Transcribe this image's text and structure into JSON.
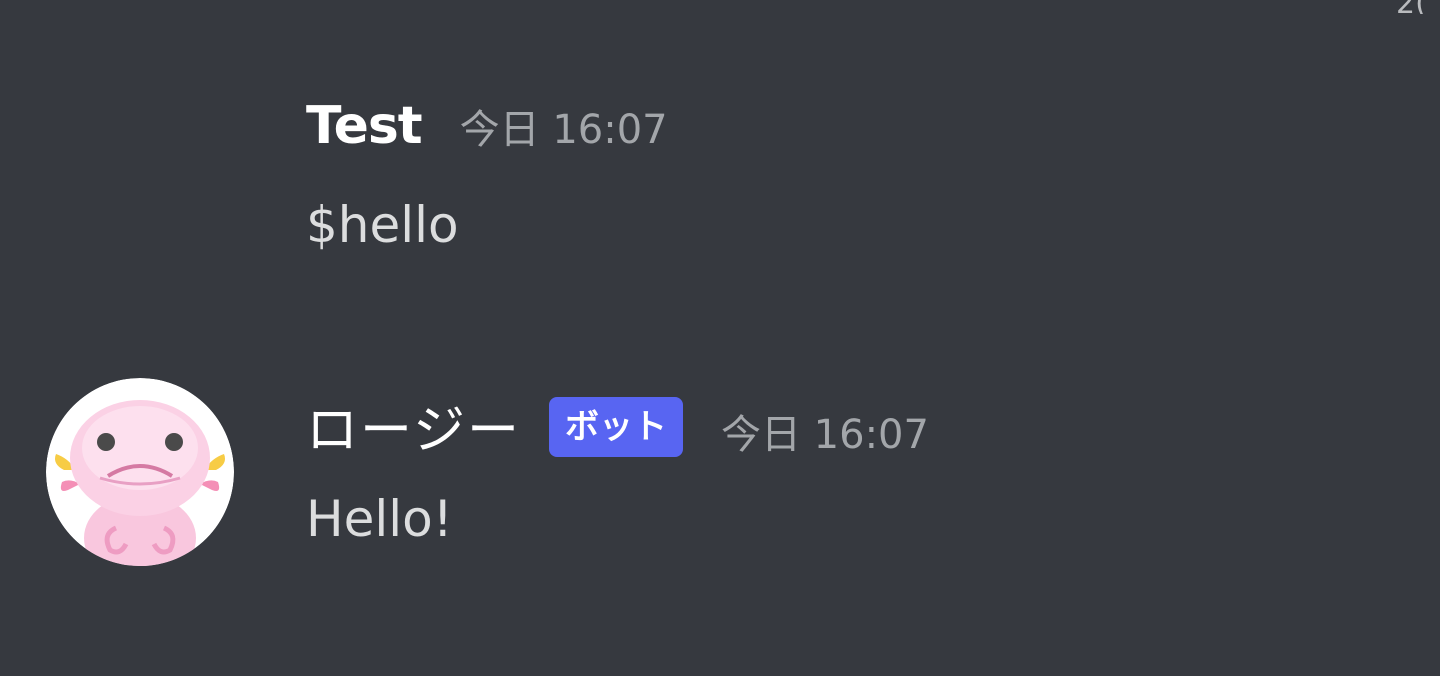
{
  "corner_text": "2(",
  "messages": [
    {
      "author": "Test",
      "timestamp": "今日 16:07",
      "content": "$hello"
    },
    {
      "author": "ロージー",
      "badge": "ボット",
      "timestamp": "今日 16:07",
      "content": "Hello!",
      "avatar_icon": "axolotl-avatar-icon"
    }
  ],
  "colors": {
    "background": "#36393f",
    "badge": "#5865f2",
    "timestamp": "#a3a6aa",
    "username": "#ffffff"
  }
}
